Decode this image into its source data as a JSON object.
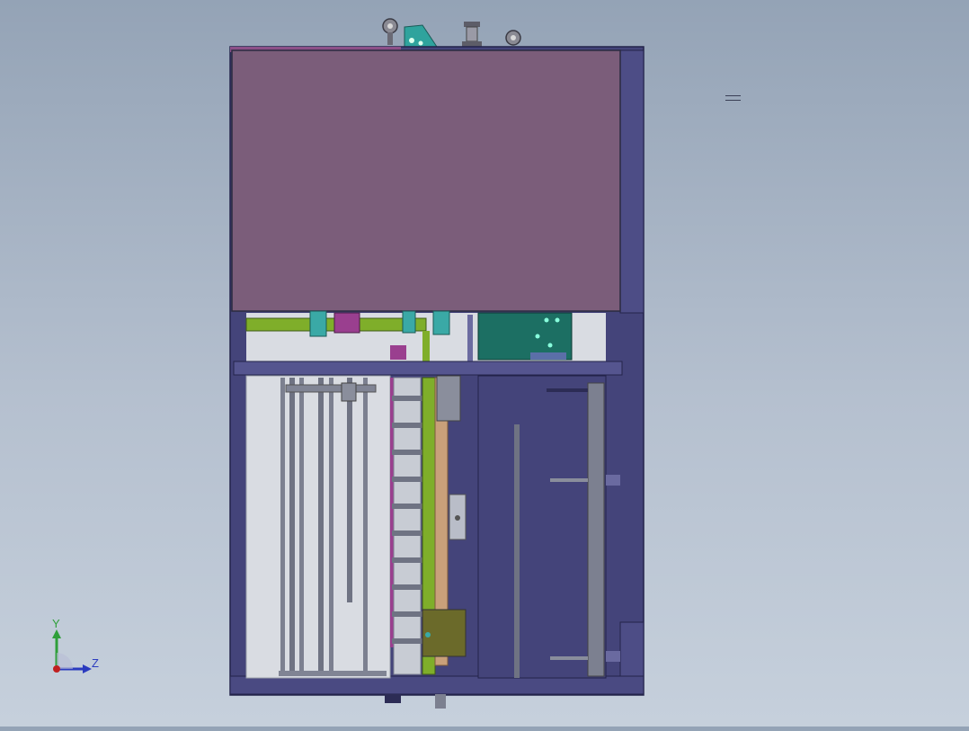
{
  "scene": {
    "background_top": "#94a3b6",
    "background_bottom": "#c6d0dc",
    "colors": {
      "frame": "#44447a",
      "frame_dark": "#2c2c55",
      "cover_panel": "#7b5d7a",
      "green_rail": "#7fae2a",
      "teal_part": "#1c6f63",
      "cyan_part": "#3aa9a6",
      "magenta_part": "#9a3f8f",
      "tan_belt": "#c9a07a",
      "steel": "#7c8090",
      "light_panel": "#d9dce2"
    }
  },
  "triad": {
    "y_label": "Y",
    "z_label": "Z",
    "icon": "coordinate-triad-icon"
  }
}
